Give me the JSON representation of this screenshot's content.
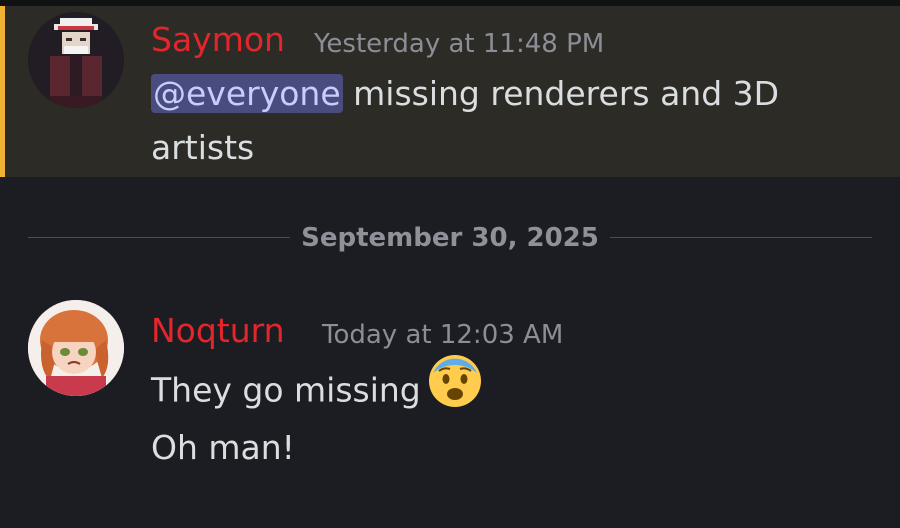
{
  "messages": [
    {
      "author": "Saymon",
      "timestamp": "Yesterday at 11:48 PM",
      "mention": "@everyone",
      "text_line1": "missing renderers and 3D",
      "text_line2": "artists",
      "highlighted": true
    },
    {
      "author": "Noqturn",
      "timestamp": "Today at 12:03 AM",
      "lines": [
        "They go missing",
        "Oh man!"
      ],
      "emoji": "anxious-face-emoji"
    }
  ],
  "date_divider": "September 30, 2025",
  "colors": {
    "author_name": "#e3252c",
    "mention_bg": "#4a4c7f",
    "highlight_bar": "#f0b232",
    "highlight_bg": "#2d2b26",
    "background": "#1c1d22"
  }
}
